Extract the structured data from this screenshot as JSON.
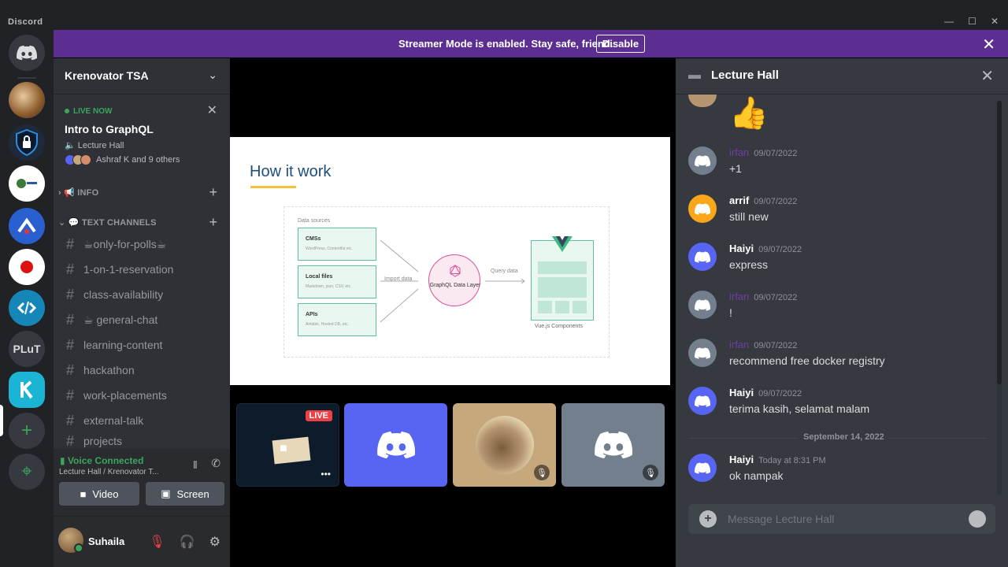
{
  "window": {
    "app_name": "Discord",
    "minimize": "—",
    "maximize": "☐",
    "close": "✕"
  },
  "banner": {
    "text": "Streamer Mode is enabled. Stay safe, friend.",
    "button": "Disable",
    "close": "✕"
  },
  "rail": {
    "plut": "PLuT",
    "add": "+",
    "explore": "⌖"
  },
  "guild": {
    "name": "Krenovator TSA",
    "live": {
      "label": "LIVE NOW",
      "title": "Intro to GraphQL",
      "channel": "Lecture Hall",
      "people": "Ashraf K and 9 others"
    },
    "categories": {
      "info": "INFO",
      "text_channels": "TEXT CHANNELS"
    },
    "channels": [
      {
        "name": "☕only-for-polls☕"
      },
      {
        "name": "1-on-1-reservation"
      },
      {
        "name": "class-availability"
      },
      {
        "name": " ☕ general-chat"
      },
      {
        "name": "learning-content"
      },
      {
        "name": "hackathon"
      },
      {
        "name": "work-placements"
      },
      {
        "name": "external-talk"
      },
      {
        "name": "projects"
      }
    ]
  },
  "voice": {
    "status": "Voice Connected",
    "channel": "Lecture Hall / Krenovator T...",
    "video": "Video",
    "screen": "Screen"
  },
  "user": {
    "name": "Suhaila"
  },
  "slide": {
    "title": "How it work",
    "data_sources_label": "Data sources",
    "sources": [
      {
        "title": "CMSs",
        "sub": "WordPress, Contentful etc."
      },
      {
        "title": "Local files",
        "sub": "Markdown, json, CSV, etc."
      },
      {
        "title": "APIs",
        "sub": "Airtable, Hosted DB, etc."
      }
    ],
    "import_label": "Import data",
    "query_label": "Query data",
    "gql_label": "GraphQL Data Layer",
    "vue_label": "Vue.js Components"
  },
  "tiles": {
    "live_badge": "LIVE",
    "dots": "•••"
  },
  "chat": {
    "title": "Lecture Hall",
    "date_divider": "September 14, 2022",
    "placeholder": "Message Lecture Hall",
    "messages": [
      {
        "author": "irfan",
        "time": "09/07/2022",
        "text": "+1",
        "color": "#72767d",
        "hidden": true
      },
      {
        "author": "arrif",
        "time": "09/07/2022",
        "text": "still new",
        "color": "#faa61a"
      },
      {
        "author": "Haiyi",
        "time": "09/07/2022",
        "text": "express",
        "color": "#5865f2"
      },
      {
        "author": "irfan",
        "time": "09/07/2022",
        "text": "!",
        "color": "#72767d",
        "hidden": true
      },
      {
        "author": "irfan",
        "time": "09/07/2022",
        "text": "recommend free docker registry",
        "color": "#72767d",
        "hidden": true
      },
      {
        "author": "Haiyi",
        "time": "09/07/2022",
        "text": "terima kasih, selamat malam",
        "color": "#5865f2"
      },
      {
        "author": "Haiyi",
        "time": "Today at 8:31 PM",
        "text": "ok nampak",
        "color": "#5865f2"
      }
    ]
  }
}
